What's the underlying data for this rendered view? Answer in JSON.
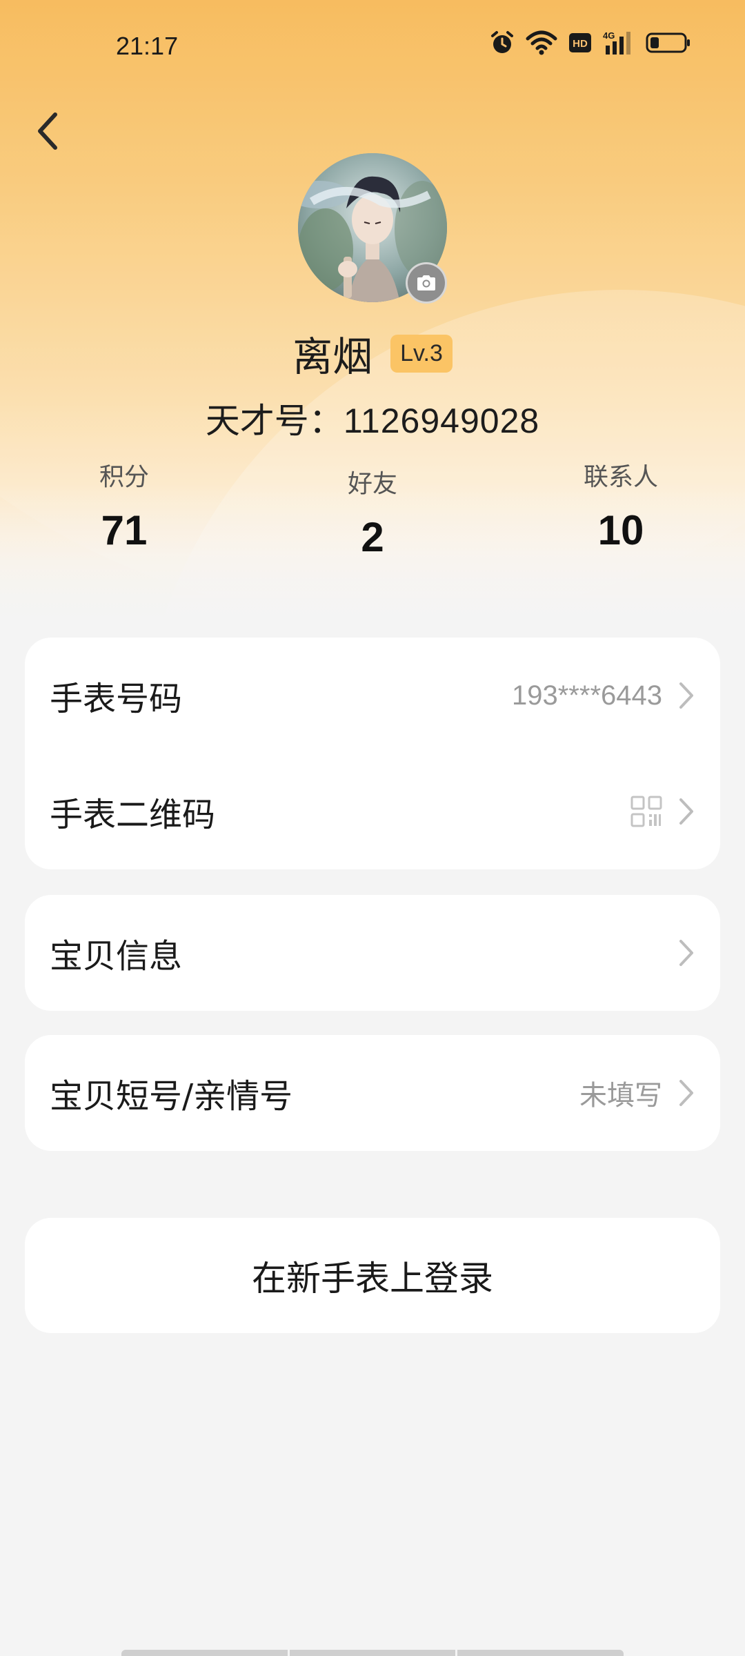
{
  "status_bar": {
    "time": "21:17",
    "network": "4G",
    "hd_label": "HD",
    "icons": [
      "alarm-icon",
      "wifi-icon",
      "hd-icon",
      "signal-icon",
      "battery-icon"
    ]
  },
  "profile": {
    "name": "离烟",
    "level": "Lv.3",
    "id_label": "天才号：",
    "id_number": "1126949028"
  },
  "stats": [
    {
      "label": "积分",
      "value": "71"
    },
    {
      "label": "好友",
      "value": "2"
    },
    {
      "label": "联系人",
      "value": "10"
    }
  ],
  "menu": {
    "watch_number": {
      "label": "手表号码",
      "value": "193****6443"
    },
    "watch_qr": {
      "label": "手表二维码"
    },
    "baby_info": {
      "label": "宝贝信息"
    },
    "short_number": {
      "label": "宝贝短号/亲情号",
      "value": "未填写"
    }
  },
  "login_button": "在新手表上登录",
  "colors": {
    "header_top": "#f7b54e",
    "level_badge": "#fbc465",
    "page_bg": "#f4f4f4",
    "card_bg": "#ffffff",
    "secondary_text": "#9a9a9a"
  }
}
